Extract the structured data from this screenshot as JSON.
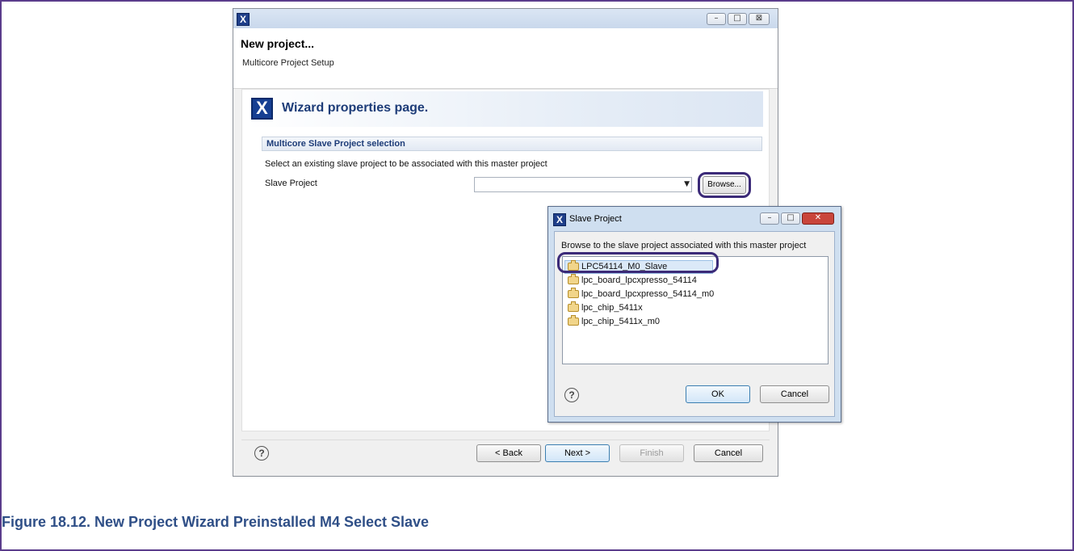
{
  "wizard": {
    "title": "New project...",
    "subtitle": "Multicore Project Setup",
    "banner_title": "Wizard properties page.",
    "section_title": "Multicore Slave Project selection",
    "instruction": "Select an existing slave project to be associated with this master project",
    "field_label": "Slave Project",
    "field_value": "",
    "browse_label": "Browse...",
    "buttons": {
      "back": "< Back",
      "next": "Next >",
      "finish": "Finish",
      "cancel": "Cancel"
    },
    "help_glyph": "?",
    "window_controls": {
      "minimize": "–",
      "maximize": "□",
      "close": "⊠"
    }
  },
  "dialog": {
    "title": "Slave Project",
    "instruction": "Browse to the slave project associated with this master project",
    "items": [
      "LPC54114_M0_Slave",
      "lpc_board_lpcxpresso_54114",
      "lpc_board_lpcxpresso_54114_m0",
      "lpc_chip_5411x",
      "lpc_chip_5411x_m0"
    ],
    "selected_item": "LPC54114_M0_Slave",
    "ok_label": "OK",
    "cancel_label": "Cancel",
    "help_glyph": "?",
    "window_controls": {
      "minimize": "–",
      "maximize": "□",
      "close": "✕"
    }
  },
  "app_icon_glyph": "X",
  "caption": "Figure 18.12. New Project Wizard Preinstalled M4 Select Slave",
  "colors": {
    "highlight_ring": "#3b2a78",
    "caption": "#2f4f87",
    "close_button": "#c9453b",
    "banner_text": "#1d3c78"
  }
}
